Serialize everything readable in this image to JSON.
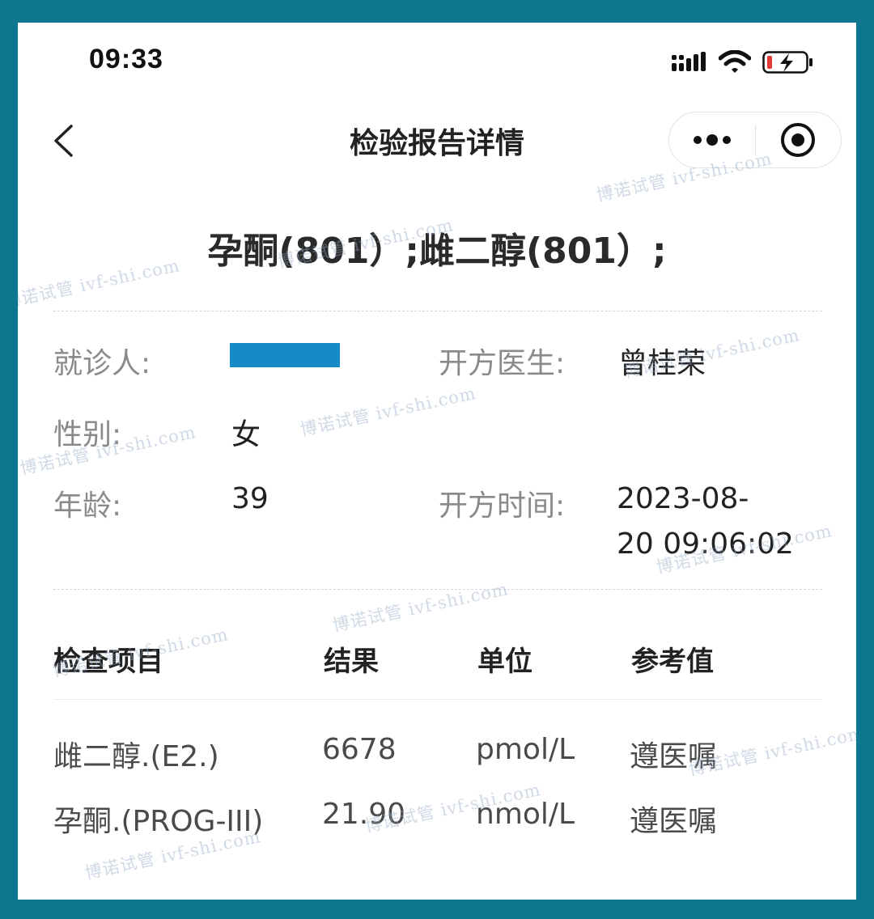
{
  "status": {
    "time": "09:33"
  },
  "nav": {
    "title": "检验报告详情"
  },
  "report": {
    "title": "孕酮(801）;雌二醇(801）;"
  },
  "patient": {
    "name_label": "就诊人:",
    "gender_label": "性别:",
    "gender": "女",
    "age_label": "年龄:",
    "age": "39",
    "doctor_label": "开方医生:",
    "doctor": "曾桂荣",
    "time_label": "开方时间:",
    "time_line1": "2023-08-",
    "time_line2": "20 09:06:02"
  },
  "table": {
    "headers": [
      "检查项目",
      "结果",
      "单位",
      "参考值"
    ],
    "rows": [
      {
        "item": "雌二醇.(E2.)",
        "result": "6678",
        "unit": "pmol/L",
        "reference": "遵医嘱"
      },
      {
        "item": "孕酮.(PROG-III)",
        "result": "21.90",
        "unit": "nmol/L",
        "reference": "遵医嘱"
      }
    ]
  },
  "watermark": "博诺试管 ivf-shi.com"
}
